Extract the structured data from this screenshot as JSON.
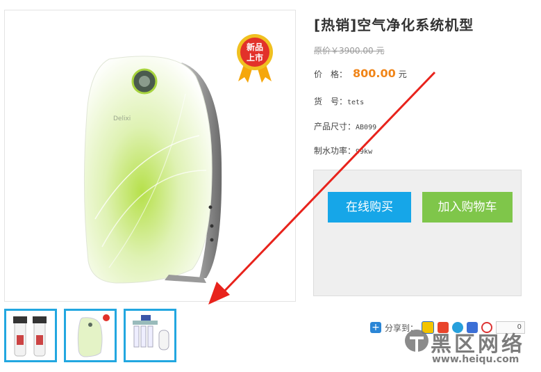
{
  "product": {
    "title": "[热销]空气净化系统机型",
    "original_price": "原价￥3900.00 元",
    "price_label": "价　格：",
    "price_value": "800.00",
    "price_unit": "元",
    "code_label": "货　号：",
    "code_value": "tets",
    "size_label": "产品尺寸：",
    "size_value": "AB099",
    "power_label": "制水功率：",
    "power_value": "99kw"
  },
  "main_image": {
    "badge_line1": "新品",
    "badge_line2": "上市",
    "brand_text": "Delixi"
  },
  "thumbnails": [
    {
      "name": "twin-filter-thumb"
    },
    {
      "name": "purifier-thumb"
    },
    {
      "name": "ro-system-thumb"
    }
  ],
  "buttons": {
    "buy_now": "在线购买",
    "add_to_cart": "加入购物车"
  },
  "share": {
    "label": "分享到：",
    "count": "0"
  },
  "watermark": {
    "title": "黑区网络",
    "url": "www.heiqu.com"
  },
  "colors": {
    "accent_blue": "#16a6e8",
    "cart_green": "#7fc64a",
    "price_orange": "#f08519",
    "thumb_border": "#22a7e0",
    "arrow_red": "#e8231c"
  }
}
